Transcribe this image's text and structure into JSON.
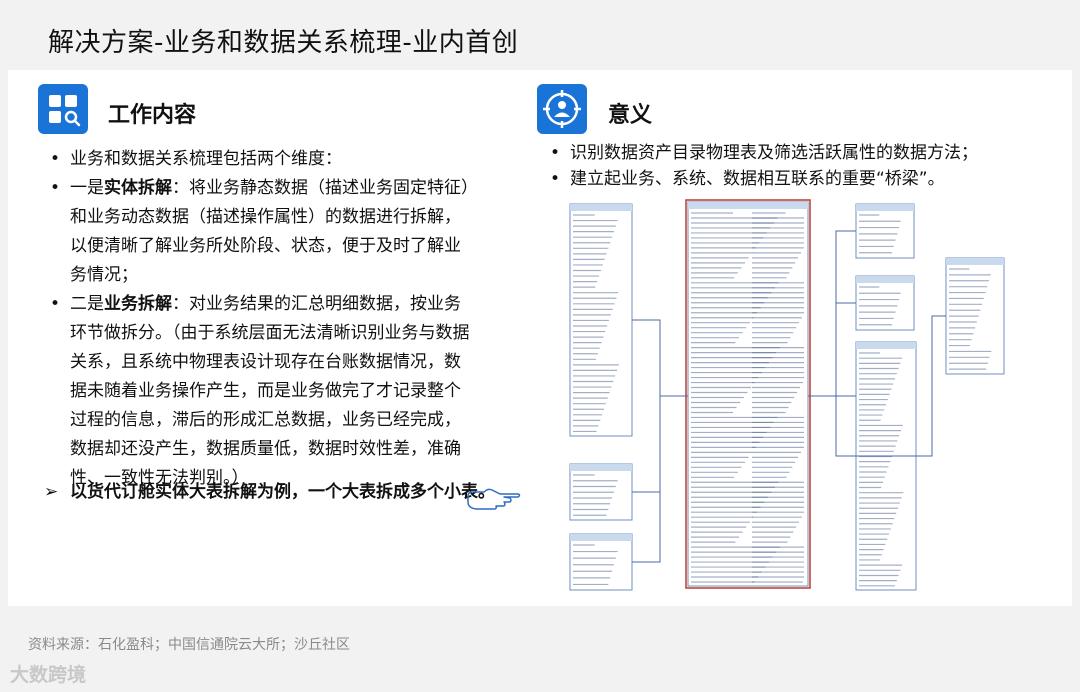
{
  "title": "解决方案-业务和数据关系梳理-业内首创",
  "left": {
    "section_title": "工作内容",
    "icon": "grid-search-icon",
    "bullets": [
      {
        "text": "业务和数据关系梳理包括两个维度："
      },
      {
        "prefix": "一是",
        "bold": "实体拆解",
        "text": "：将业务静态数据（描述业务固定特征）和业务动态数据（描述操作属性）的数据进行拆解，以便清晰了解业务所处阶段、状态，便于及时了解业务情况；"
      },
      {
        "prefix": "二是",
        "bold": "业务拆解",
        "text": "：对业务结果的汇总明细数据，按业务环节做拆分。（由于系统层面无法清晰识别业务与数据关系，且系统中物理表设计现存在台账数据情况，数据未随着业务操作产生，而是业务做完了才记录整个过程的信息，滞后的形成汇总数据，业务已经完成，数据却还没产生，数据质量低，数据时效性差，准确性、一致性无法判别。）"
      }
    ],
    "arrow_marker": "➢",
    "arrow_text": "以货代订舱实体大表拆解为例，一个大表拆成多个小表。",
    "pointer_icon": "hand-pointer-icon"
  },
  "right": {
    "section_title": "意义",
    "icon": "target-person-icon",
    "bullets": [
      "识别数据资产目录物理表及筛选活跃属性的数据方法；",
      "建立起业务、系统、数据相互联系的重要“桥梁”。"
    ]
  },
  "bullet_char": "•",
  "source": "资料来源：石化盈科；中国信通院云大所；沙丘社区",
  "logo": "大数跨境",
  "colors": {
    "accent": "#1a73d6",
    "table_header": "#c9d9ee",
    "table_border": "#6f8fbf",
    "highlight": "#c0392b"
  }
}
